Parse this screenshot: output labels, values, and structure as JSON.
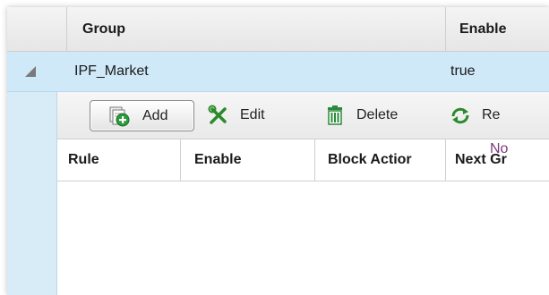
{
  "grid": {
    "columns": {
      "group": "Group",
      "enable": "Enable"
    },
    "rows": [
      {
        "group": "IPF_Market",
        "enable": "true"
      }
    ]
  },
  "subgrid": {
    "toolbar": {
      "add_label": "Add",
      "edit_label": "Edit",
      "delete_label": "Delete",
      "reload_label": "Re"
    },
    "columns": {
      "rule": "Rule",
      "enable": "Enable",
      "block_action": "Block Actior",
      "next_group": "Next Gr"
    },
    "empty_text": "No"
  },
  "icons": {
    "expand": "expand-triangle-icon",
    "add": "add-icon",
    "edit": "edit-tools-icon",
    "delete": "trash-icon",
    "reload": "reload-icon"
  },
  "colors": {
    "selected_row": "#cfe9f9",
    "add_icon": "#2a9a3a",
    "edit_icon": "#2a8a2a",
    "delete_icon": "#2a8a3a",
    "empty_text": "#7b3a7b"
  }
}
